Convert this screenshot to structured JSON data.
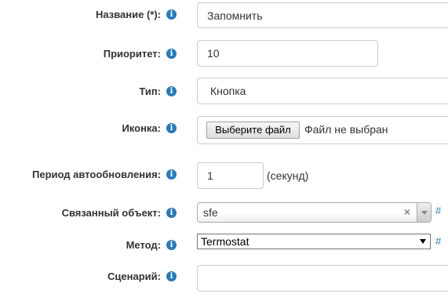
{
  "form": {
    "name": {
      "label": "Название (*):",
      "value": "Запомнить"
    },
    "priority": {
      "label": "Приоритет:",
      "value": "10"
    },
    "type": {
      "label": "Тип:",
      "value": "Кнопка"
    },
    "icon": {
      "label": "Иконка:",
      "button": "Выберите файл",
      "status": "Файл не выбран"
    },
    "refresh": {
      "label": "Период автообновления:",
      "value": "1",
      "suffix": "(секунд)"
    },
    "linked_object": {
      "label": "Связанный объект:",
      "value": "sfe",
      "clear": "×",
      "hash": "#"
    },
    "method": {
      "label": "Метод:",
      "value": "Termostat",
      "hash": "#"
    },
    "scenario": {
      "label": "Сценарий:",
      "value": ""
    }
  },
  "info_glyph": "i",
  "icons": {
    "info": "info-icon",
    "clear": "clear-icon",
    "dropdown": "chevron-down-icon"
  },
  "colors": {
    "info": "#2a7ab8",
    "link": "#2a7ab8",
    "border": "#cccccc"
  }
}
